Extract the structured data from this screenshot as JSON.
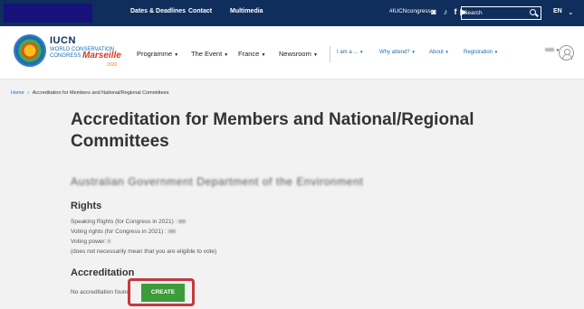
{
  "topbar": {
    "links": [
      "Dates & Deadlines",
      "Contact",
      "Multimedia"
    ],
    "hashtag": "#IUCNcongress",
    "social_icons": [
      "instagram-icon",
      "twitter-icon",
      "facebook-icon",
      "youtube-icon"
    ],
    "search_placeholder": "Search",
    "language": "EN",
    "colors": {
      "background": "#0f2e5c",
      "logo_block": "#16127a"
    }
  },
  "brand": {
    "line1": "IUCN",
    "line2": "WORLD CONSERVATION",
    "line3": "CONGRESS",
    "city": "Marseille",
    "year": "2020"
  },
  "main_nav": [
    "Programme",
    "The Event",
    "France",
    "Newsroom"
  ],
  "secondary_nav": [
    "I am a ...",
    "Why attend?",
    "About",
    "Registration"
  ],
  "breadcrumb": {
    "home": "Home",
    "separator": "»",
    "current": "Accreditation for Members and National/Regional Committees"
  },
  "page": {
    "title": "Accreditation for Members and National/Regional Committees",
    "organization": "Australian Government Department of the Environment",
    "rights_heading": "Rights",
    "speaking_rights": "Speaking Rights (for Congress in 2021) :",
    "voting_rights": "Voting rights (for Congress in 2021) :",
    "voting_power": "Voting power:",
    "note": "(does not necessarily mean that you are eligible to vote)",
    "accreditation_heading": "Accreditation",
    "no_accreditation": "No accreditation found.",
    "create_label": "CREATE"
  },
  "colors": {
    "create_button": "#3e9b3a",
    "highlight_box": "#c4393d",
    "link": "#1f6db3"
  }
}
